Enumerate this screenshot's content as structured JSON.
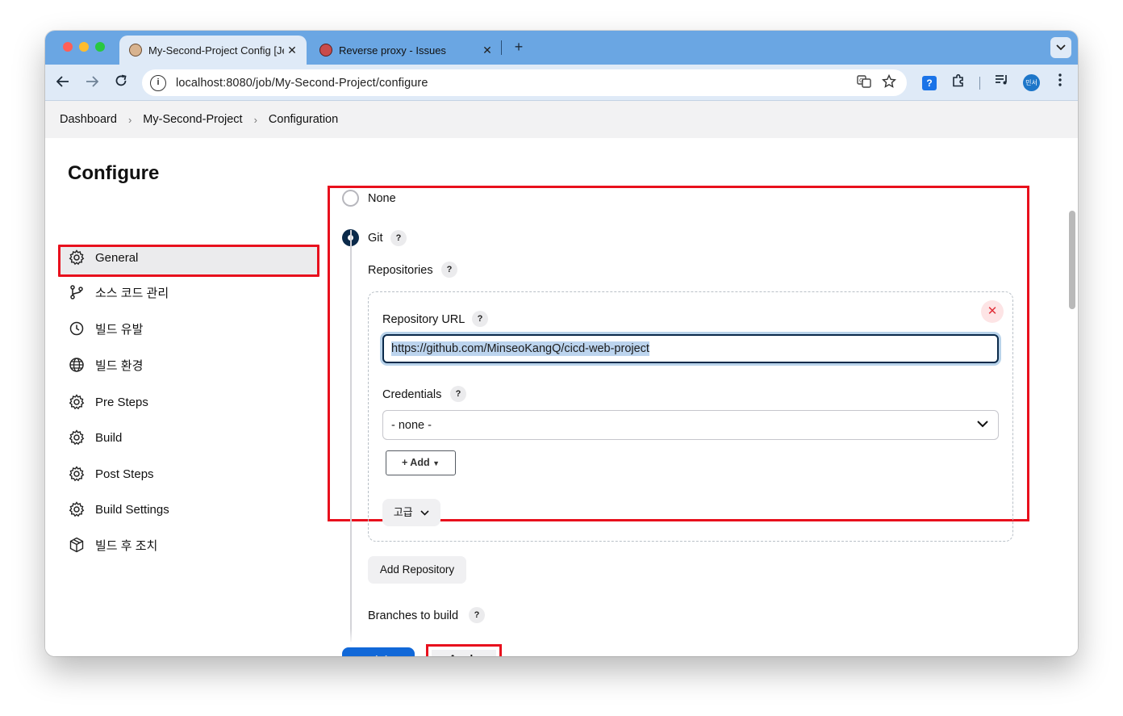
{
  "browser": {
    "tabs": [
      {
        "title": "My-Second-Project Config [Jenkins]",
        "active": true
      },
      {
        "title": "Reverse proxy - Issues",
        "active": false
      }
    ],
    "tab_close": "✕",
    "new_tab": "+",
    "address": "localhost:8080/job/My-Second-Project/configure",
    "profile": "민서"
  },
  "breadcrumb": [
    "Dashboard",
    "My-Second-Project",
    "Configuration"
  ],
  "sidebar": {
    "title": "Configure",
    "items": [
      {
        "label": "General",
        "icon": "gear-icon"
      },
      {
        "label": "소스 코드 관리",
        "icon": "git-branch-icon",
        "active": true
      },
      {
        "label": "빌드 유발",
        "icon": "timer-icon"
      },
      {
        "label": "빌드 환경",
        "icon": "globe-icon"
      },
      {
        "label": "Pre Steps",
        "icon": "gear-icon"
      },
      {
        "label": "Build",
        "icon": "gear-icon"
      },
      {
        "label": "Post Steps",
        "icon": "gear-icon"
      },
      {
        "label": "Build Settings",
        "icon": "gear-icon"
      },
      {
        "label": "빌드 후 조치",
        "icon": "package-icon"
      }
    ]
  },
  "scm": {
    "none_label": "None",
    "git_label": "Git",
    "repositories_label": "Repositories",
    "repo_url_label": "Repository URL",
    "repo_url_value": "https://github.com/MinseoKangQ/cicd-web-project",
    "credentials_label": "Credentials",
    "credentials_value": "- none -",
    "add_label": "Add",
    "advanced_label": "고급",
    "add_repository_label": "Add Repository",
    "branches_label": "Branches to build",
    "help": "?"
  },
  "footer": {
    "save_label": "저장",
    "apply_label": "Apply"
  },
  "colors": {
    "accent": "#1168d8",
    "highlight": "#e8101d",
    "tabstrip": "#6aa6e3",
    "radio_on": "#0b2a4a"
  }
}
